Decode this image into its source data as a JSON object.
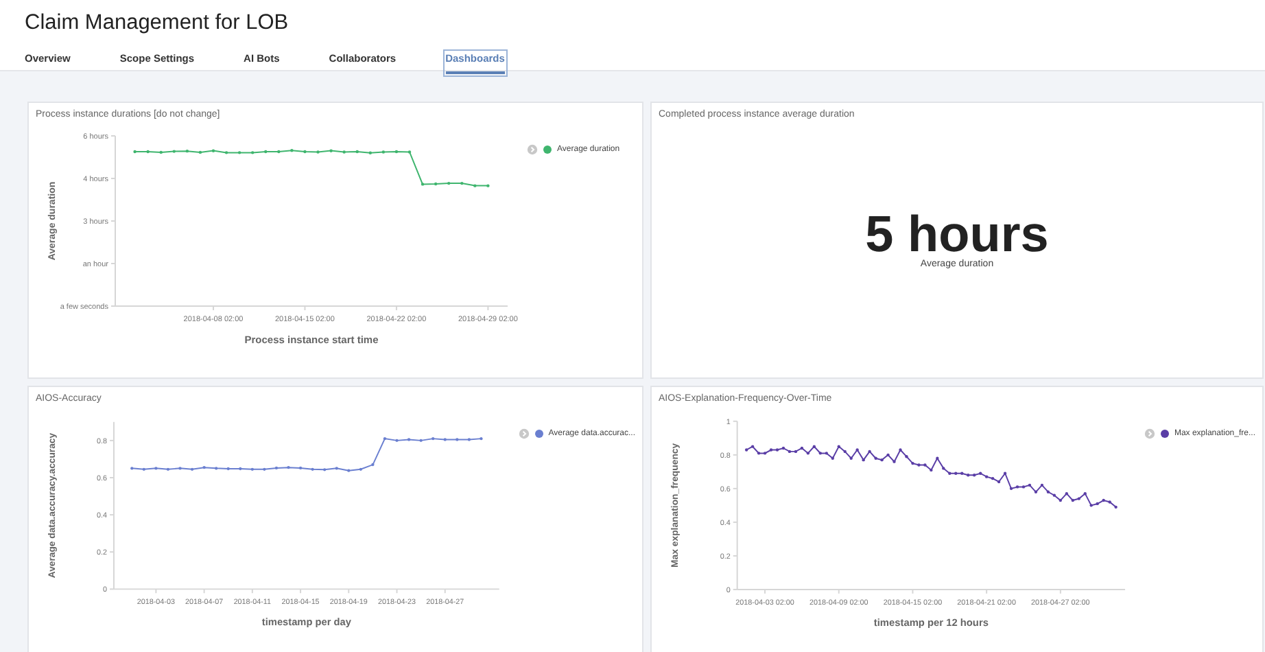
{
  "title": "Claim Management for LOB",
  "tabs": [
    {
      "label": "Overview",
      "selected": false
    },
    {
      "label": "Scope Settings",
      "selected": false
    },
    {
      "label": "AI Bots",
      "selected": false
    },
    {
      "label": "Collaborators",
      "selected": false
    },
    {
      "label": "Dashboards",
      "selected": true
    }
  ],
  "panels": [
    {
      "kind": "chart",
      "title": "Process instance durations [do not change]",
      "chart_data": {
        "type": "line",
        "xlabel": "Process instance start time",
        "ylabel": "Average duration",
        "ylim": [
          0,
          5.6
        ],
        "yticks": [
          {
            "value": 0,
            "label": "a few seconds"
          },
          {
            "value": 1.4,
            "label": "an hour"
          },
          {
            "value": 2.8,
            "label": "3 hours"
          },
          {
            "value": 4.2,
            "label": "4 hours"
          },
          {
            "value": 5.6,
            "label": "6 hours"
          }
        ],
        "categories": [
          null,
          null,
          null,
          null,
          null,
          null,
          "2018-04-08 02:00",
          null,
          null,
          null,
          null,
          null,
          null,
          "2018-04-15 02:00",
          null,
          null,
          null,
          null,
          null,
          null,
          "2018-04-22 02:00",
          null,
          null,
          null,
          null,
          null,
          null,
          "2018-04-29 02:00"
        ],
        "series": [
          {
            "name": "Average duration",
            "color": "#3fb56e",
            "values": [
              5.08,
              5.08,
              5.06,
              5.09,
              5.1,
              5.06,
              5.11,
              5.05,
              5.05,
              5.05,
              5.08,
              5.08,
              5.12,
              5.08,
              5.07,
              5.11,
              5.07,
              5.08,
              5.04,
              5.07,
              5.08,
              5.07,
              4.01,
              4.02,
              4.04,
              4.04,
              3.96,
              3.96
            ]
          }
        ]
      }
    },
    {
      "kind": "metric",
      "title": "Completed process instance average duration",
      "value": "5 hours",
      "caption": "Average duration"
    },
    {
      "kind": "chart",
      "title": "AIOS-Accuracy",
      "chart_data": {
        "type": "line",
        "xlabel": "timestamp per day",
        "ylabel": "Average data.accuracy.accuracy",
        "ylim": [
          0,
          0.9
        ],
        "yticks": [
          0,
          0.2,
          0.4,
          0.6,
          0.8
        ],
        "categories": [
          null,
          null,
          "2018-04-03",
          null,
          null,
          null,
          "2018-04-07",
          null,
          null,
          null,
          "2018-04-11",
          null,
          null,
          null,
          "2018-04-15",
          null,
          null,
          null,
          "2018-04-19",
          null,
          null,
          null,
          "2018-04-23",
          null,
          null,
          null,
          "2018-04-27",
          null,
          null,
          null
        ],
        "series": [
          {
            "name": "Average data.accurac...",
            "color": "#6a7fd0",
            "values": [
              0.65,
              0.645,
              0.65,
              0.645,
              0.65,
              0.645,
              0.655,
              0.65,
              0.648,
              0.648,
              0.645,
              0.645,
              0.652,
              0.655,
              0.652,
              0.645,
              0.643,
              0.65,
              0.638,
              0.645,
              0.67,
              0.81,
              0.8,
              0.805,
              0.8,
              0.81,
              0.805,
              0.805,
              0.805,
              0.81
            ]
          }
        ]
      }
    },
    {
      "kind": "chart",
      "title": "AIOS-Explanation-Frequency-Over-Time",
      "chart_data": {
        "type": "line",
        "xlabel": "timestamp per 12 hours",
        "ylabel": "Max explanation_frequency",
        "ylim": [
          0,
          1
        ],
        "yticks": [
          0,
          0.2,
          0.4,
          0.6,
          0.8,
          1
        ],
        "categories": [
          null,
          null,
          null,
          "2018-04-03 02:00",
          null,
          null,
          null,
          null,
          null,
          null,
          null,
          null,
          null,
          null,
          null,
          "2018-04-09 02:00",
          null,
          null,
          null,
          null,
          null,
          null,
          null,
          null,
          null,
          null,
          null,
          "2018-04-15 02:00",
          null,
          null,
          null,
          null,
          null,
          null,
          null,
          null,
          null,
          null,
          null,
          "2018-04-21 02:00",
          null,
          null,
          null,
          null,
          null,
          null,
          null,
          null,
          null,
          null,
          null,
          "2018-04-27 02:00",
          null,
          null,
          null,
          null,
          null,
          null,
          null,
          null,
          null
        ],
        "series": [
          {
            "name": "Max explanation_fre...",
            "color": "#5a3ea6",
            "values": [
              0.83,
              0.85,
              0.81,
              0.81,
              0.83,
              0.83,
              0.84,
              0.82,
              0.82,
              0.84,
              0.81,
              0.85,
              0.81,
              0.81,
              0.78,
              0.85,
              0.82,
              0.78,
              0.83,
              0.77,
              0.82,
              0.78,
              0.77,
              0.8,
              0.76,
              0.83,
              0.79,
              0.75,
              0.74,
              0.74,
              0.71,
              0.78,
              0.72,
              0.69,
              0.69,
              0.69,
              0.68,
              0.68,
              0.69,
              0.67,
              0.66,
              0.64,
              0.69,
              0.6,
              0.61,
              0.61,
              0.62,
              0.58,
              0.62,
              0.58,
              0.56,
              0.53,
              0.57,
              0.53,
              0.54,
              0.57,
              0.5,
              0.51,
              0.53,
              0.52,
              0.49
            ]
          }
        ]
      }
    }
  ]
}
